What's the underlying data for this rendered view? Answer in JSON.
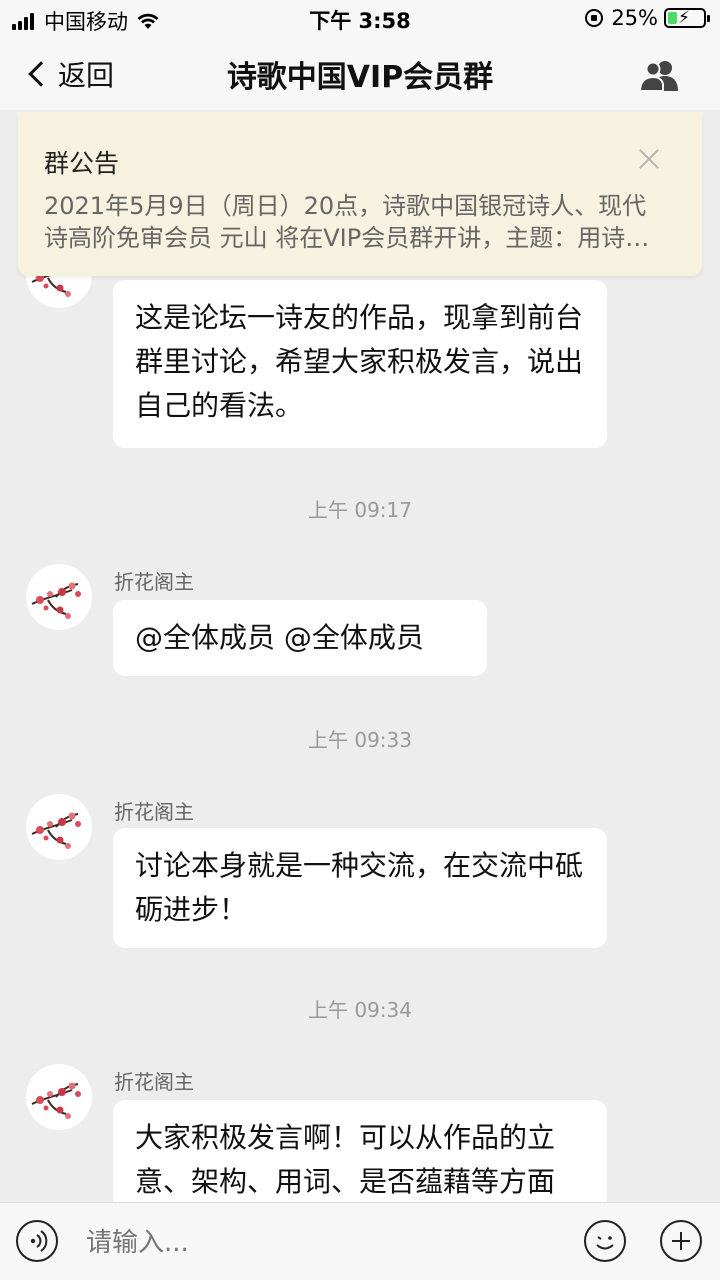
{
  "status_bar": {
    "carrier": "中国移动",
    "time": "下午 3:58",
    "battery": "25%",
    "battery_level": 0.25,
    "icons": [
      "signal-icon",
      "wifi-icon",
      "orientation-lock-icon",
      "battery-icon"
    ]
  },
  "nav": {
    "back_label": "返回",
    "title": "诗歌中国VIP会员群",
    "members_icon": "group-members-icon"
  },
  "announcement": {
    "title": "群公告",
    "line1": "2021年5月9日（周日）20点，诗歌中国银冠诗人、现代",
    "line2": "诗高阶免审会员 元山 将在VIP会员群开讲，主题：用诗…"
  },
  "messages": [
    {
      "sender": "",
      "text": "这是论坛一诗友的作品，现拿到前台群里讨论，希望大家积极发言，说出自己的看法。"
    },
    {
      "timestamp": "上午 09:17",
      "sender": "折花阁主",
      "text": "@全体成员  @全体成员"
    },
    {
      "timestamp": "上午 09:33",
      "sender": "折花阁主",
      "text": "讨论本身就是一种交流，在交流中砥砺进步！"
    },
    {
      "timestamp": "上午 09:34",
      "sender": "折花阁主",
      "text": "大家积极发言啊！可以从作品的立意、架构、用词、是否蕴藉等方面"
    }
  ],
  "input": {
    "placeholder": "请输入...",
    "icons": [
      "voice-icon",
      "emoji-icon",
      "plus-icon"
    ]
  },
  "colors": {
    "background": "#ededed",
    "bubble": "#ffffff",
    "announcement_bg": "#f7f2e0",
    "battery_green": "#4cd964"
  }
}
